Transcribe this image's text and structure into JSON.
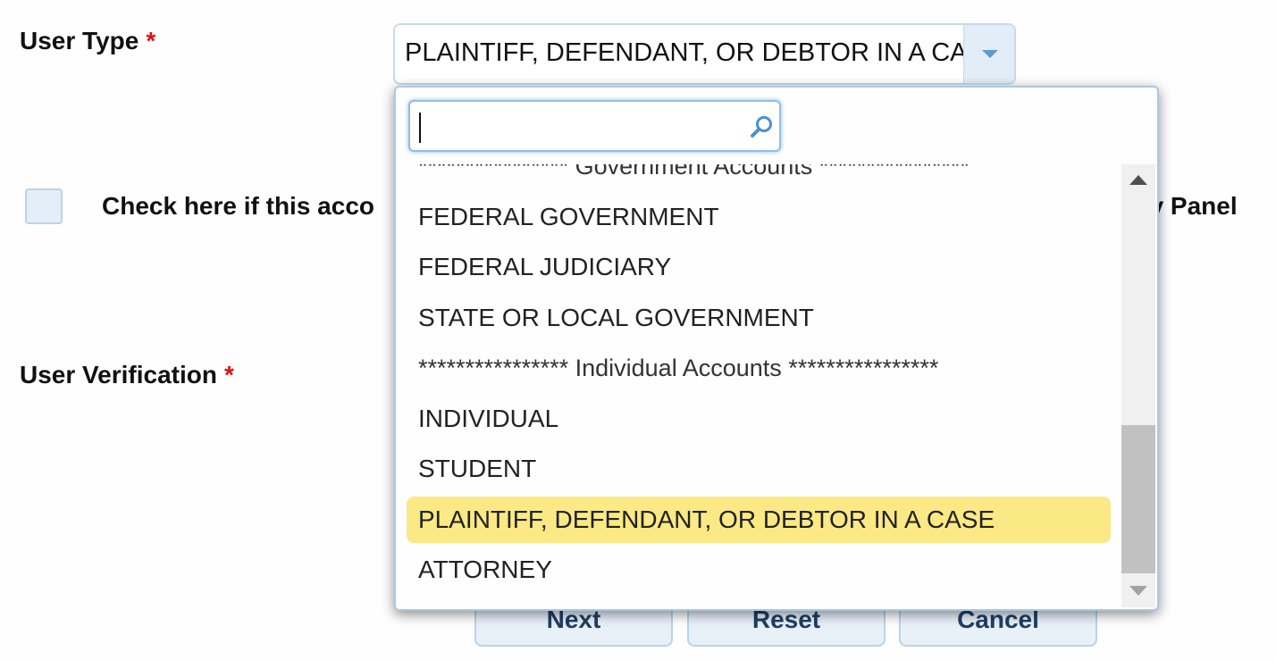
{
  "form": {
    "user_type_label": "User Type",
    "user_verification_label": "User Verification",
    "required_marker": "*",
    "checkbox_text_start": "Check here if this acco",
    "checkbox_text_end": "ey Panel"
  },
  "select": {
    "current_value": "PLAINTIFF, DEFENDANT, OR DEBTOR IN A CASE",
    "search_value": "",
    "options": [
      {
        "label": "**************** Government Accounts ****************",
        "group": true
      },
      {
        "label": "FEDERAL GOVERNMENT"
      },
      {
        "label": "FEDERAL JUDICIARY"
      },
      {
        "label": "STATE OR LOCAL GOVERNMENT"
      },
      {
        "label": "**************** Individual Accounts ****************",
        "group": true
      },
      {
        "label": "INDIVIDUAL"
      },
      {
        "label": "STUDENT"
      },
      {
        "label": "PLAINTIFF, DEFENDANT, OR DEBTOR IN A CASE",
        "selected": true
      },
      {
        "label": "ATTORNEY"
      }
    ]
  },
  "buttons": {
    "next": "Next",
    "reset": "Reset",
    "cancel": "Cancel"
  },
  "colors": {
    "highlight": "#fbe985",
    "accent": "#5b9bd5",
    "required": "#e01010"
  },
  "icons": {
    "search": "search-icon",
    "dropdown_arrow": "chevron-down-icon"
  }
}
